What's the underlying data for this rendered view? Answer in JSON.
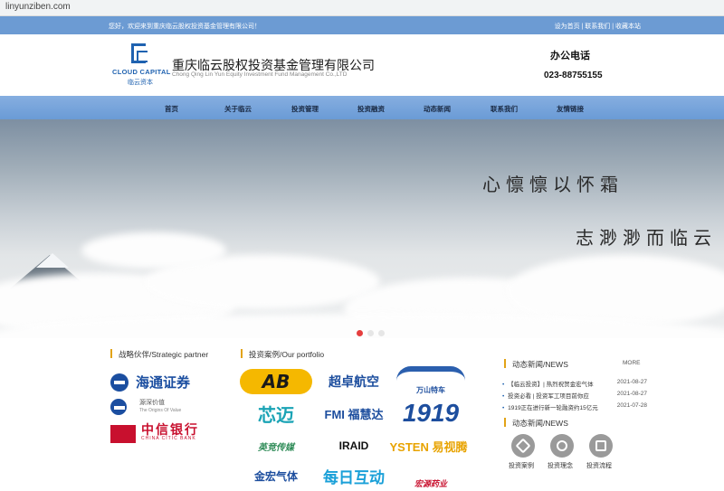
{
  "browser": {
    "url": "linyunziben.com"
  },
  "topbar": {
    "welcome": "您好，欢迎来到重庆临云股权投资基金管理有限公司！",
    "links": "设为首页 | 联系我们 | 收藏本站"
  },
  "header": {
    "logo_en": "CLOUD CAPITAL",
    "logo_cn": "临云资本",
    "company_cn": "重庆临云股权投资基金管理有限公司",
    "company_en": "Chong Qing Lin Yun Equity Investment Fund Management Co.,LTD",
    "phone_title": "办公电话",
    "phone": "023-88755155"
  },
  "nav": [
    "首页",
    "关于临云",
    "投资管理",
    "投资融资",
    "动态新闻",
    "联系我们",
    "友情链接"
  ],
  "banner": {
    "line1": "心懔懔以怀霜",
    "line2": "志渺渺而临云",
    "slide_count": 3,
    "active_slide": 1
  },
  "partners": {
    "title": "战略伙伴/Strategic partner",
    "items": [
      "海通证券",
      "源深价值",
      "中信银行"
    ],
    "sub": [
      "The Origins Of Value",
      "CHINA CITIC BANK"
    ]
  },
  "portfolio": {
    "title": "投资案例/Our portfolio",
    "items": [
      "AB",
      "超卓航空",
      "万山特车",
      "芯迈",
      "FMI 福慧达",
      "1919",
      "英竞传媒",
      "IRAID",
      "YSTEN 易视腾",
      "金宏气体",
      "每日互动",
      "宏源药业"
    ]
  },
  "news": {
    "title": "动态新闻/NEWS",
    "more": "MORE",
    "items": [
      {
        "text": "【临云投资】| 热烈祝贺金宏气体",
        "date": "2021-08-27"
      },
      {
        "text": "投资必看 | 投资军工项目前你应",
        "date": "2021-08-27"
      },
      {
        "text": "1919正在进行新一轮融资约15亿元",
        "date": "2021-07-28"
      }
    ],
    "title2": "动态新闻/NEWS"
  },
  "quick": [
    "投资案例",
    "投资理念",
    "投资流程"
  ],
  "colors": {
    "topbar": "#6c9bd3",
    "nav": "#7aa6dc",
    "brand": "#1f62b0",
    "accent": "#e2a317"
  }
}
